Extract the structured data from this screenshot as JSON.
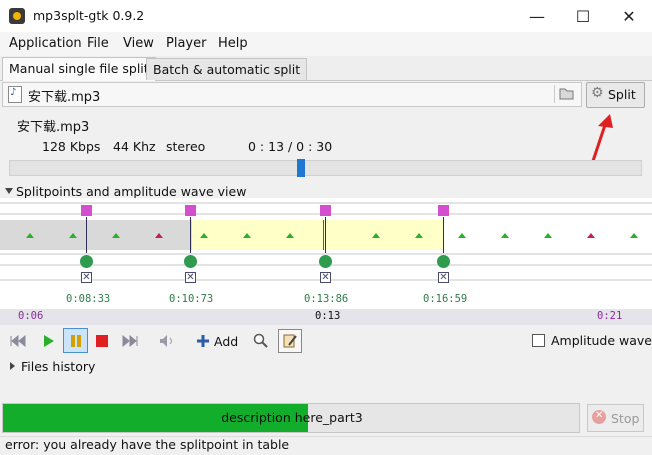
{
  "window": {
    "title": "mp3splt-gtk 0.9.2",
    "minimize": "—",
    "maximize": "☐",
    "close": "✕"
  },
  "menu": [
    "Application",
    "File",
    "View",
    "Player",
    "Help"
  ],
  "tabs": [
    "Manual single file split",
    "Batch & automatic split"
  ],
  "file": {
    "path": "安下载.mp3",
    "split_label": "Split"
  },
  "info": {
    "name": "安下载.mp3",
    "bitrate": "128 Kbps",
    "frequency": "44 Khz",
    "mode": "stereo",
    "time": "0 : 13 / 0 : 30"
  },
  "progress_position": 0.46,
  "wave_section": {
    "title": "Splitpoints and amplitude wave view"
  },
  "splitpoints": [
    {
      "time": "0:08:33"
    },
    {
      "time": "0:10:73"
    },
    {
      "time": "0:13:86"
    },
    {
      "time": "0:16:59"
    }
  ],
  "timeline": {
    "start": "0:06",
    "middle": "0:13",
    "end": "0:21"
  },
  "toolbar": {
    "add_label": "Add",
    "amplitude_label": "Amplitude wave"
  },
  "files_history": "Files history",
  "split_progress": {
    "description": "description here_part3",
    "fraction": 0.53,
    "stop_label": "Stop"
  },
  "status": "error: you already have the splitpoint in table",
  "colors": {
    "progress": "#11ad2b",
    "splitpoint": "#d44ed0",
    "selection": "#ffffc8",
    "accent": "#1f77d0"
  }
}
